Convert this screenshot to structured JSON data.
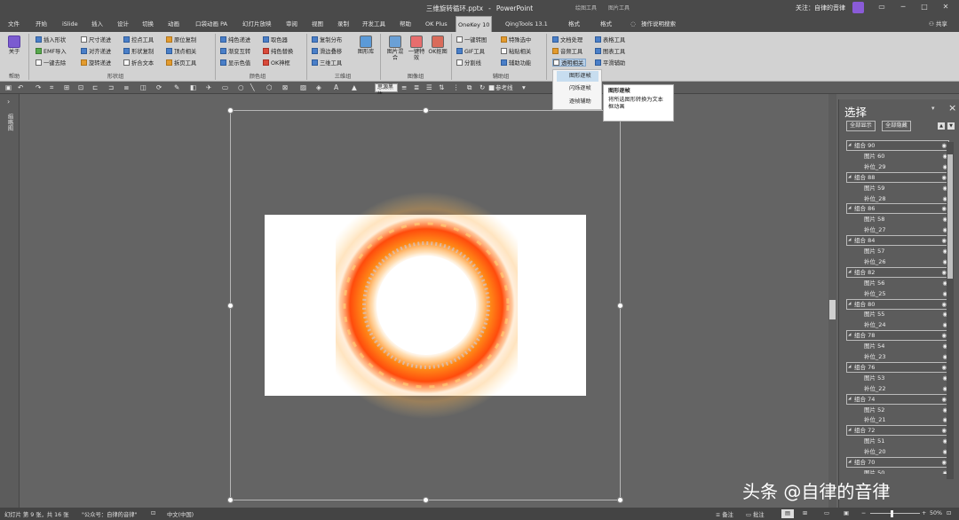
{
  "titlebar": {
    "filename": "三维旋转循环.pptx",
    "separator": "-",
    "app": "PowerPoint",
    "ctx_draw": "绘图工具",
    "ctx_picture": "图片工具",
    "follow": "关注：自律的音律",
    "share": "共享"
  },
  "tabs": [
    "文件",
    "开始",
    "iSlide",
    "插入",
    "设计",
    "切换",
    "动画",
    "口袋动画 PA",
    "幻灯片放映",
    "审阅",
    "视图",
    "录制",
    "开发工具",
    "帮助",
    "OK Plus",
    "OneKey 10",
    "QingTools 13.1",
    "格式",
    "格式",
    "操作说明搜索"
  ],
  "ribbon": {
    "about": "关于",
    "help_group": "帮助",
    "col1": [
      "插入形状",
      "EMF导入",
      "一键去除"
    ],
    "col2": [
      "尺寸递进",
      "对齐递进",
      "旋转递进"
    ],
    "col3": [
      "控点工具",
      "形状复制",
      "折合文本"
    ],
    "col4": [
      "原位复制",
      "顶点相关",
      "拆页工具"
    ],
    "shape_group": "形状组",
    "col5": [
      "纯色递进",
      "渐变互转",
      "显示色值"
    ],
    "col6": [
      "取色器",
      "纯色替换",
      "OK神框"
    ],
    "color_group": "颜色组",
    "col7": [
      "复制分布",
      "滑边叠移",
      "三维工具"
    ],
    "graph_lib": "图形库",
    "three_d_group": "三维组",
    "img_mix": "图片混合",
    "one_key_special": "一键特效",
    "ok_cutout": "OK抠图",
    "image_group": "图像组",
    "col8": [
      "一键转图",
      "GIF工具",
      "分割线"
    ],
    "col9": [
      "特殊选中",
      "粘贴相关",
      "辅助功能"
    ],
    "assist_group": "辅助组",
    "col10": [
      "文档处理",
      "音频工具",
      "透明相关"
    ],
    "col11": [
      "表格工具",
      "图表工具",
      "平滑辅助"
    ]
  },
  "dropdown": [
    "图形逐帧",
    "闪烁逐帧",
    "逐帧辅助"
  ],
  "tooltip": {
    "title": "图形逐帧",
    "body": "将所选图形转换为文本框动画"
  },
  "qat": {
    "font": "思源黑体",
    "ref_line": "参考线"
  },
  "left_tab": "缩略图",
  "selection_pane": {
    "title": "选择",
    "show_all": "全部显示",
    "hide_all": "全部隐藏",
    "items": [
      {
        "name": "组合 90",
        "type": "group"
      },
      {
        "name": "图片 60",
        "type": "child"
      },
      {
        "name": "补位_29",
        "type": "child"
      },
      {
        "name": "组合 88",
        "type": "group"
      },
      {
        "name": "图片 59",
        "type": "child"
      },
      {
        "name": "补位_28",
        "type": "child"
      },
      {
        "name": "组合 86",
        "type": "group"
      },
      {
        "name": "图片 58",
        "type": "child"
      },
      {
        "name": "补位_27",
        "type": "child"
      },
      {
        "name": "组合 84",
        "type": "group"
      },
      {
        "name": "图片 57",
        "type": "child"
      },
      {
        "name": "补位_26",
        "type": "child"
      },
      {
        "name": "组合 82",
        "type": "group"
      },
      {
        "name": "图片 56",
        "type": "child"
      },
      {
        "name": "补位_25",
        "type": "child"
      },
      {
        "name": "组合 80",
        "type": "group"
      },
      {
        "name": "图片 55",
        "type": "child"
      },
      {
        "name": "补位_24",
        "type": "child"
      },
      {
        "name": "组合 78",
        "type": "group"
      },
      {
        "name": "图片 54",
        "type": "child"
      },
      {
        "name": "补位_23",
        "type": "child"
      },
      {
        "name": "组合 76",
        "type": "group"
      },
      {
        "name": "图片 53",
        "type": "child"
      },
      {
        "name": "补位_22",
        "type": "child"
      },
      {
        "name": "组合 74",
        "type": "group"
      },
      {
        "name": "图片 52",
        "type": "child"
      },
      {
        "name": "补位_21",
        "type": "child"
      },
      {
        "name": "组合 72",
        "type": "group"
      },
      {
        "name": "图片 51",
        "type": "child"
      },
      {
        "name": "补位_20",
        "type": "child"
      },
      {
        "name": "组合 70",
        "type": "group"
      },
      {
        "name": "图片 50",
        "type": "child"
      }
    ]
  },
  "status": {
    "slide": "幻灯片 第 9 张，共 16 张",
    "theme": "\"公众号：自律的音律\"",
    "lang": "中文(中国)",
    "notes": "备注",
    "comments": "批注",
    "zoom": "50%"
  },
  "watermark": "头条 @自律的音律"
}
